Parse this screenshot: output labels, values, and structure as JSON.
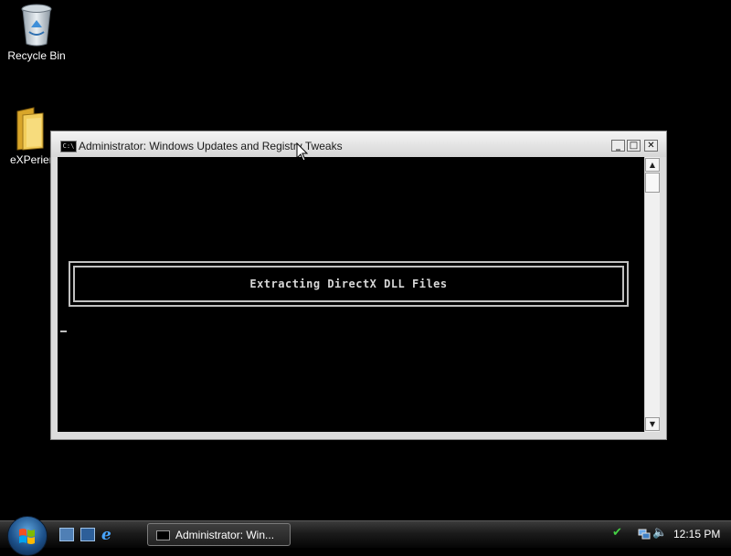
{
  "desktop": {
    "icons": [
      {
        "label": "Recycle Bin",
        "icon": "recycle-bin-icon"
      },
      {
        "label": "eXPerien",
        "icon": "folder-icon"
      }
    ]
  },
  "window": {
    "title": "Administrator:  Windows Updates and Registry Tweaks",
    "icon": "console-icon",
    "controls": {
      "minimize": "minimize-icon",
      "maximize": "maximize-icon",
      "close": "close-icon"
    },
    "console_message": "Extracting DirectX DLL Files"
  },
  "taskbar": {
    "start": "start-orb-icon",
    "quick_launch": [
      "show-desktop-icon",
      "switch-windows-icon",
      "internet-explorer-icon"
    ],
    "ie_glyph": "e",
    "task_button_label": "Administrator:  Win...",
    "tray_icons": [
      "security-check-icon",
      "network-icon",
      "volume-muted-icon"
    ],
    "clock": "12:15 PM"
  },
  "colors": {
    "desktop_background": "#000000",
    "console_background": "#000000",
    "console_text": "#d8d8d8"
  }
}
